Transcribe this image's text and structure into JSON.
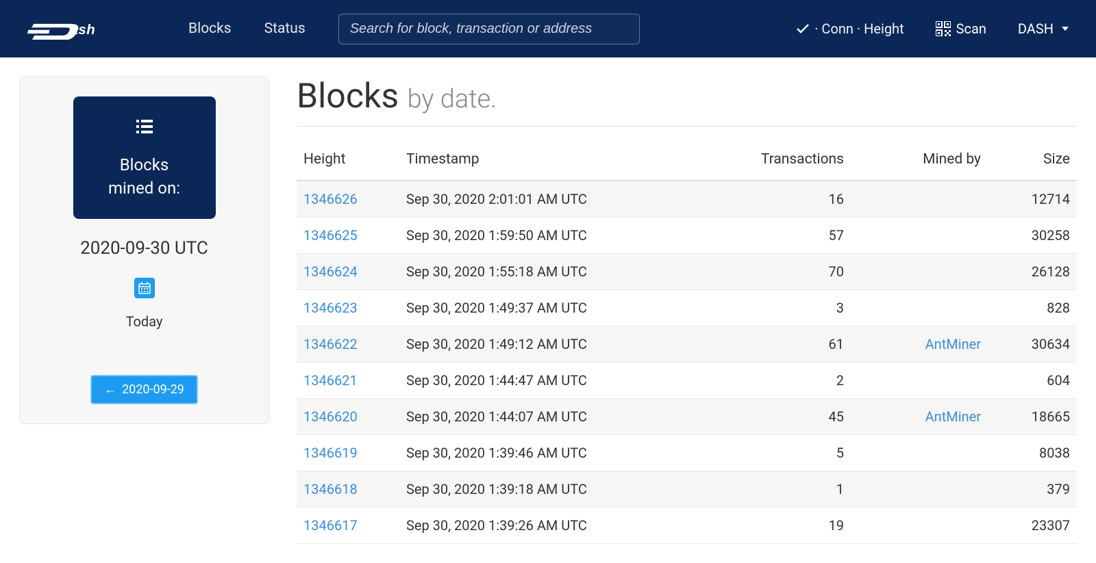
{
  "nav": {
    "brand": "Dash",
    "links": {
      "blocks": "Blocks",
      "status": "Status"
    },
    "search_placeholder": "Search for block, transaction or address",
    "conn_status": "· Conn · Height",
    "scan": "Scan",
    "currency": "DASH"
  },
  "sidebar": {
    "card_text_line1": "Blocks",
    "card_text_line2": "mined on:",
    "date": "2020-09-30 UTC",
    "today": "Today",
    "prev_date": "2020-09-29"
  },
  "page": {
    "title": "Blocks",
    "subtitle": "by date."
  },
  "table": {
    "headers": {
      "height": "Height",
      "timestamp": "Timestamp",
      "transactions": "Transactions",
      "mined_by": "Mined by",
      "size": "Size"
    },
    "rows": [
      {
        "height": "1346626",
        "timestamp": "Sep 30, 2020 2:01:01 AM UTC",
        "transactions": "16",
        "mined_by": "",
        "size": "12714"
      },
      {
        "height": "1346625",
        "timestamp": "Sep 30, 2020 1:59:50 AM UTC",
        "transactions": "57",
        "mined_by": "",
        "size": "30258"
      },
      {
        "height": "1346624",
        "timestamp": "Sep 30, 2020 1:55:18 AM UTC",
        "transactions": "70",
        "mined_by": "",
        "size": "26128"
      },
      {
        "height": "1346623",
        "timestamp": "Sep 30, 2020 1:49:37 AM UTC",
        "transactions": "3",
        "mined_by": "",
        "size": "828"
      },
      {
        "height": "1346622",
        "timestamp": "Sep 30, 2020 1:49:12 AM UTC",
        "transactions": "61",
        "mined_by": "AntMiner",
        "size": "30634"
      },
      {
        "height": "1346621",
        "timestamp": "Sep 30, 2020 1:44:47 AM UTC",
        "transactions": "2",
        "mined_by": "",
        "size": "604"
      },
      {
        "height": "1346620",
        "timestamp": "Sep 30, 2020 1:44:07 AM UTC",
        "transactions": "45",
        "mined_by": "AntMiner",
        "size": "18665"
      },
      {
        "height": "1346619",
        "timestamp": "Sep 30, 2020 1:39:46 AM UTC",
        "transactions": "5",
        "mined_by": "",
        "size": "8038"
      },
      {
        "height": "1346618",
        "timestamp": "Sep 30, 2020 1:39:18 AM UTC",
        "transactions": "1",
        "mined_by": "",
        "size": "379"
      },
      {
        "height": "1346617",
        "timestamp": "Sep 30, 2020 1:39:26 AM UTC",
        "transactions": "19",
        "mined_by": "",
        "size": "23307"
      }
    ]
  }
}
